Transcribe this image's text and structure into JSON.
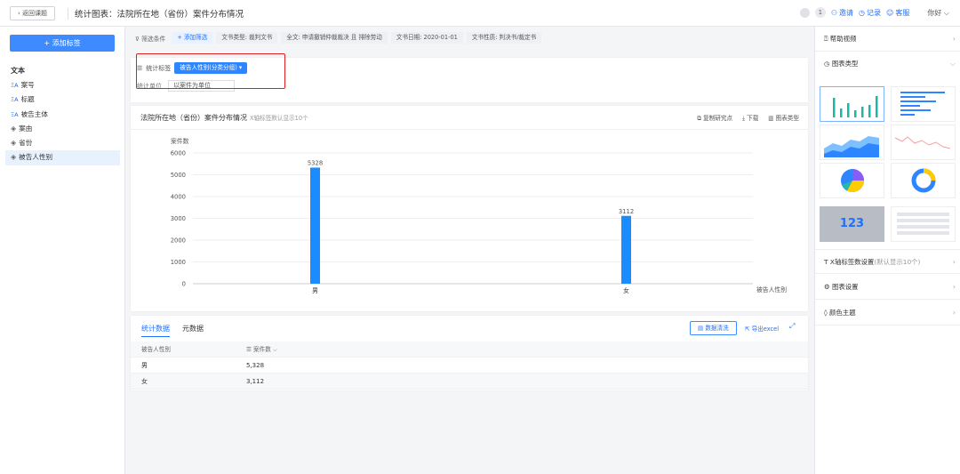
{
  "topbar": {
    "back_label": "返回课题",
    "title": "统计图表：法院所在地（省份）案件分布情况",
    "count": "1",
    "invite": "邀请",
    "record": "记录",
    "service": "客服",
    "user": "你好"
  },
  "sidebar": {
    "add_tag_label": "+ 添加标签",
    "category": "文本",
    "items": [
      {
        "label": "案号",
        "icon": "text-type-icon"
      },
      {
        "label": "标题",
        "icon": "text-type-icon"
      },
      {
        "label": "被告主体",
        "icon": "text-type-icon"
      },
      {
        "label": "案由",
        "icon": "layers-icon"
      },
      {
        "label": "省份",
        "icon": "layers-icon"
      },
      {
        "label": "被告人性别",
        "icon": "layers-icon"
      }
    ]
  },
  "filters": {
    "label": "筛选条件",
    "add_label": "+ 添加筛选",
    "chips": [
      "文书类型: 裁判文书",
      "全文: 申请撤销仲裁裁决 且 排除劳动",
      "文书日期: 2020-01-01",
      "文书性质: 判决书/裁定书"
    ]
  },
  "stat": {
    "label": "统计标签",
    "tag": "被告人性别(分类分组)",
    "unit_label": "统计单位",
    "unit_value": "以案件为单位"
  },
  "chart_panel": {
    "title": "法院所在地（省份）案件分布情况",
    "hint": "X轴标签默认显示10个",
    "tools": [
      "复制研究点",
      "下载",
      "图表类型"
    ]
  },
  "chart_data": {
    "type": "bar",
    "categories": [
      "男",
      "女"
    ],
    "values": [
      5328,
      3112
    ],
    "xlabel": "被告人性别",
    "ylabel": "案件数",
    "ylim": [
      0,
      6000
    ],
    "yticks": [
      0,
      1000,
      2000,
      3000,
      4000,
      5000,
      6000
    ],
    "color": "#1a8cff",
    "grid": true
  },
  "table": {
    "tabs": [
      "统计数据",
      "元数据"
    ],
    "clean_label": "数据清洗",
    "export_label": "导出excel",
    "headers": [
      "被告人性别",
      "案件数"
    ],
    "rows": [
      [
        "男",
        "5,328"
      ],
      [
        "女",
        "3,112"
      ]
    ]
  },
  "rightbar": {
    "help": "帮助视频",
    "chart_type": "图表类型",
    "xaxis_setting": "X轴标签数设置",
    "xaxis_hint": "(默认显示10个)",
    "chart_setting": "图表设置",
    "color_theme": "颜色主题",
    "kpi_value": "123"
  }
}
